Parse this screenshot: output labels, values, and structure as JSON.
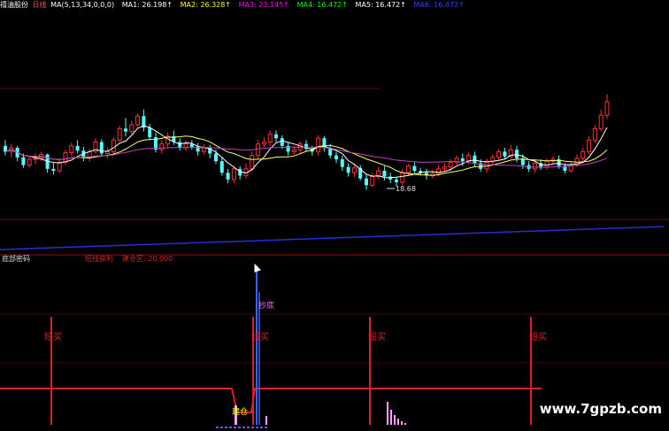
{
  "header": {
    "stock_name": "禧油股份",
    "period": "日线",
    "params": "MA(5,13,34,0,0,0)",
    "ma_items": [
      {
        "label": "MA1: 26.198↑",
        "color": "#ffffff"
      },
      {
        "label": "MA2: 26.328↑",
        "color": "#ffff00"
      },
      {
        "label": "MA3: 23.145↑",
        "color": "#ff00ff"
      },
      {
        "label": "MA4: 16.472↑",
        "color": "#00ff00"
      },
      {
        "label": "MA5: 16.472↑",
        "color": "#ffffff"
      },
      {
        "label": "MA6: 16.472↑",
        "color": "#3a3aff"
      }
    ]
  },
  "sub_panel": {
    "title": "底部密码",
    "field1": "短线获利",
    "field2": "建仓区: 20.000"
  },
  "annotations": {
    "low_price": "18.68",
    "buy_labels": [
      "短买",
      "短买",
      "短买",
      "短买"
    ],
    "chao_di": "抄底",
    "jian_cang": "建仓"
  },
  "watermark": "www.7gpzb.com",
  "colors": {
    "bull": "#ff3232",
    "bear": "#54ffff",
    "ma5": "#ffffff",
    "ma13": "#ffff66",
    "ma34": "#c040c0",
    "long_ma": "#2a2ad8",
    "signal": "#e02020",
    "spike": "#4060ff"
  },
  "chart_data": {
    "type": "candlestick",
    "ylim": [
      17,
      29
    ],
    "series": [
      {
        "name": "price",
        "values": [
          [
            23.2,
            22.6,
            23.8,
            22.2
          ],
          [
            22.6,
            23.0,
            23.4,
            22.0
          ],
          [
            23.0,
            22.0,
            23.2,
            21.6
          ],
          [
            22.0,
            21.2,
            22.4,
            20.9
          ],
          [
            21.2,
            21.8,
            22.1,
            20.9
          ],
          [
            21.8,
            21.9,
            22.4,
            21.3
          ],
          [
            21.9,
            22.3,
            22.6,
            21.6
          ],
          [
            22.3,
            20.8,
            22.4,
            20.4
          ],
          [
            20.8,
            20.6,
            21.4,
            20.2
          ],
          [
            20.6,
            21.5,
            21.8,
            20.4
          ],
          [
            21.5,
            22.5,
            22.8,
            21.2
          ],
          [
            22.5,
            23.2,
            23.5,
            22.1
          ],
          [
            23.2,
            22.7,
            23.8,
            22.4
          ],
          [
            22.7,
            22.0,
            23.1,
            21.6
          ],
          [
            22.0,
            22.6,
            22.9,
            21.6
          ],
          [
            22.6,
            23.6,
            24.0,
            22.4
          ],
          [
            23.6,
            22.4,
            23.9,
            22.1
          ],
          [
            22.4,
            22.6,
            23.0,
            21.9
          ],
          [
            22.6,
            23.8,
            24.1,
            22.2
          ],
          [
            23.8,
            25.0,
            25.3,
            23.6
          ],
          [
            25.0,
            24.7,
            26.1,
            24.2
          ],
          [
            24.7,
            25.4,
            25.8,
            24.4
          ],
          [
            25.4,
            26.3,
            26.6,
            25.2
          ],
          [
            26.3,
            25.1,
            27.0,
            24.7
          ],
          [
            25.1,
            24.1,
            25.5,
            23.8
          ],
          [
            24.1,
            22.8,
            24.6,
            22.5
          ],
          [
            22.8,
            23.4,
            23.8,
            22.4
          ],
          [
            23.4,
            24.2,
            24.6,
            23.0
          ],
          [
            24.2,
            23.6,
            24.8,
            23.3
          ],
          [
            23.6,
            23.0,
            24.0,
            22.7
          ],
          [
            23.0,
            23.4,
            23.8,
            22.7
          ],
          [
            23.4,
            23.1,
            23.8,
            22.8
          ],
          [
            23.1,
            22.6,
            23.5,
            22.2
          ],
          [
            22.6,
            23.0,
            23.4,
            22.3
          ],
          [
            23.0,
            22.4,
            23.3,
            21.9
          ],
          [
            22.4,
            21.6,
            22.8,
            21.3
          ],
          [
            21.6,
            20.4,
            22.0,
            20.1
          ],
          [
            20.4,
            19.7,
            20.8,
            19.3
          ],
          [
            19.7,
            20.8,
            21.1,
            19.3
          ],
          [
            20.8,
            20.1,
            21.1,
            19.7
          ],
          [
            20.1,
            20.8,
            21.4,
            19.8
          ],
          [
            20.8,
            22.2,
            22.6,
            20.6
          ],
          [
            22.2,
            23.4,
            23.8,
            21.8
          ],
          [
            23.4,
            23.6,
            24.1,
            23.1
          ],
          [
            23.6,
            24.4,
            24.8,
            23.2
          ],
          [
            24.4,
            24.0,
            24.8,
            23.6
          ],
          [
            24.0,
            23.2,
            24.3,
            22.9
          ],
          [
            23.2,
            22.6,
            23.6,
            22.2
          ],
          [
            22.6,
            22.8,
            23.2,
            22.3
          ],
          [
            22.8,
            23.4,
            23.7,
            22.4
          ],
          [
            23.4,
            22.9,
            23.8,
            22.6
          ],
          [
            22.9,
            22.6,
            23.2,
            22.2
          ],
          [
            22.6,
            24.0,
            24.3,
            22.2
          ],
          [
            24.0,
            23.0,
            24.2,
            22.6
          ],
          [
            23.0,
            22.2,
            23.4,
            21.9
          ],
          [
            22.2,
            21.8,
            22.6,
            21.4
          ],
          [
            21.8,
            21.0,
            22.2,
            20.6
          ],
          [
            21.0,
            20.4,
            21.4,
            20.0
          ],
          [
            20.4,
            20.9,
            21.2,
            19.9
          ],
          [
            20.9,
            19.8,
            21.2,
            19.6
          ],
          [
            19.8,
            19.1,
            20.2,
            18.6
          ],
          [
            19.1,
            20.0,
            20.4,
            18.9
          ],
          [
            20.0,
            20.6,
            21.0,
            19.7
          ],
          [
            20.6,
            20.0,
            21.1,
            19.6
          ],
          [
            20.0,
            19.7,
            20.4,
            19.3
          ],
          [
            19.7,
            19.4,
            20.0,
            19.0
          ],
          [
            19.4,
            20.4,
            20.8,
            19.1
          ],
          [
            20.4,
            21.1,
            21.3,
            20.1
          ],
          [
            21.1,
            20.6,
            21.5,
            20.3
          ],
          [
            20.6,
            20.4,
            20.9,
            20.1
          ],
          [
            20.4,
            20.1,
            20.8,
            19.7
          ],
          [
            20.1,
            20.3,
            20.7,
            19.8
          ],
          [
            20.3,
            20.8,
            21.2,
            20.0
          ],
          [
            20.8,
            21.0,
            21.4,
            20.5
          ],
          [
            21.0,
            21.5,
            21.8,
            20.6
          ],
          [
            21.5,
            21.9,
            22.2,
            21.2
          ],
          [
            21.9,
            21.6,
            22.4,
            21.1
          ],
          [
            21.6,
            22.2,
            22.5,
            21.3
          ],
          [
            22.2,
            21.4,
            22.6,
            21.0
          ],
          [
            21.4,
            20.8,
            21.8,
            20.5
          ],
          [
            20.8,
            21.6,
            21.9,
            20.4
          ],
          [
            21.6,
            22.0,
            22.3,
            21.2
          ],
          [
            22.0,
            22.6,
            22.9,
            21.7
          ],
          [
            22.6,
            22.1,
            23.0,
            21.8
          ],
          [
            22.1,
            22.8,
            23.3,
            21.9
          ],
          [
            22.8,
            21.9,
            23.2,
            21.5
          ],
          [
            21.9,
            21.2,
            22.3,
            20.8
          ],
          [
            21.2,
            20.8,
            21.6,
            20.5
          ],
          [
            20.8,
            21.4,
            21.8,
            20.4
          ],
          [
            21.4,
            21.0,
            21.8,
            20.7
          ],
          [
            21.0,
            21.6,
            21.9,
            20.7
          ],
          [
            21.6,
            21.8,
            22.1,
            21.3
          ],
          [
            21.8,
            21.1,
            22.2,
            20.8
          ],
          [
            21.1,
            20.6,
            21.4,
            20.3
          ],
          [
            20.6,
            21.2,
            21.5,
            20.4
          ],
          [
            21.2,
            21.9,
            22.3,
            21.0
          ],
          [
            21.9,
            22.6,
            23.0,
            21.6
          ],
          [
            22.6,
            23.8,
            24.2,
            22.3
          ],
          [
            23.8,
            25.0,
            25.4,
            23.5
          ],
          [
            25.0,
            26.4,
            27.0,
            24.7
          ],
          [
            26.4,
            27.8,
            28.6,
            26.0
          ]
        ]
      }
    ]
  }
}
